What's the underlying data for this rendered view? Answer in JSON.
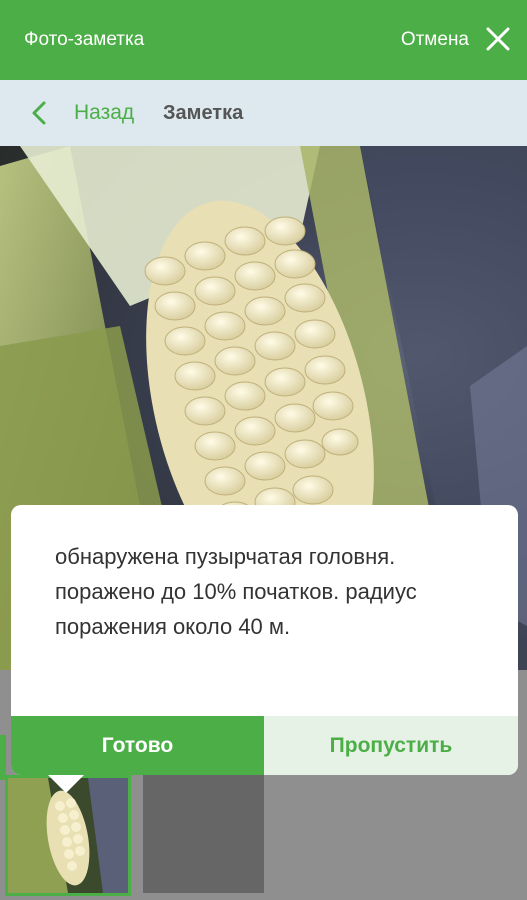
{
  "header": {
    "title": "Фото-заметка",
    "cancel_label": "Отмена"
  },
  "nav": {
    "back_label": "Назад",
    "page_title": "Заметка"
  },
  "note": {
    "text": "обнаружена пузырчатая головня. поражено  до 10% початков. радиус поражения около 40 м."
  },
  "actions": {
    "done_label": "Готово",
    "skip_label": "Пропустить"
  },
  "colors": {
    "accent": "#4cae47",
    "nav_bg": "#dde9ef",
    "skip_bg": "#e6f2e5"
  }
}
